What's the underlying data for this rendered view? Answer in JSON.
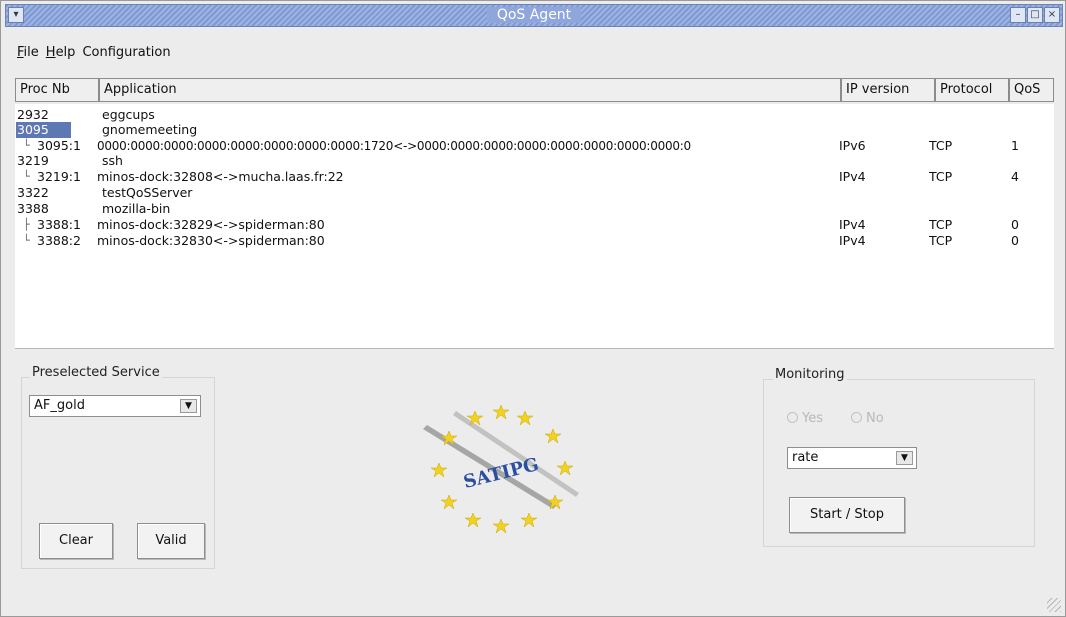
{
  "window": {
    "title": "QoS Agent"
  },
  "menu": {
    "file": "File",
    "help": "Help",
    "configuration": "Configuration"
  },
  "table": {
    "headers": {
      "proc": "Proc Nb",
      "app": "Application",
      "ip": "IP version",
      "protocol": "Protocol",
      "qos": "QoS"
    },
    "rows": [
      {
        "proc": "2932",
        "app": "eggcups",
        "ip": "",
        "protocol": "",
        "qos": ""
      },
      {
        "proc": "3095",
        "app": "gnomemeeting",
        "ip": "",
        "protocol": "",
        "qos": "",
        "selected": true
      },
      {
        "proc": "3095:1",
        "app": "0000:0000:0000:0000:0000:0000:0000:0000:1720<->0000:0000:0000:0000:0000:0000:0000:0000:0",
        "ip": "IPv6",
        "protocol": "TCP",
        "qos": "1"
      },
      {
        "proc": "3219",
        "app": "ssh",
        "ip": "",
        "protocol": "",
        "qos": ""
      },
      {
        "proc": "3219:1",
        "app": "minos-dock:32808<->mucha.laas.fr:22",
        "ip": "IPv4",
        "protocol": "TCP",
        "qos": "4"
      },
      {
        "proc": "3322",
        "app": "testQoSServer",
        "ip": "",
        "protocol": "",
        "qos": ""
      },
      {
        "proc": "3388",
        "app": "mozilla-bin",
        "ip": "",
        "protocol": "",
        "qos": ""
      },
      {
        "proc": "3388:1",
        "app": "minos-dock:32829<->spiderman:80",
        "ip": "IPv4",
        "protocol": "TCP",
        "qos": "0"
      },
      {
        "proc": "3388:2",
        "app": "minos-dock:32830<->spiderman:80",
        "ip": "IPv4",
        "protocol": "TCP",
        "qos": "0"
      }
    ]
  },
  "preselected": {
    "label": "Preselected Service",
    "selected_value": "AF_gold",
    "clear": "Clear",
    "valid": "Valid"
  },
  "logo": {
    "text": "SATIPG"
  },
  "monitoring": {
    "label": "Monitoring",
    "radio_yes": "Yes",
    "radio_no": "No",
    "selected_value": "rate",
    "start_stop": "Start / Stop"
  }
}
